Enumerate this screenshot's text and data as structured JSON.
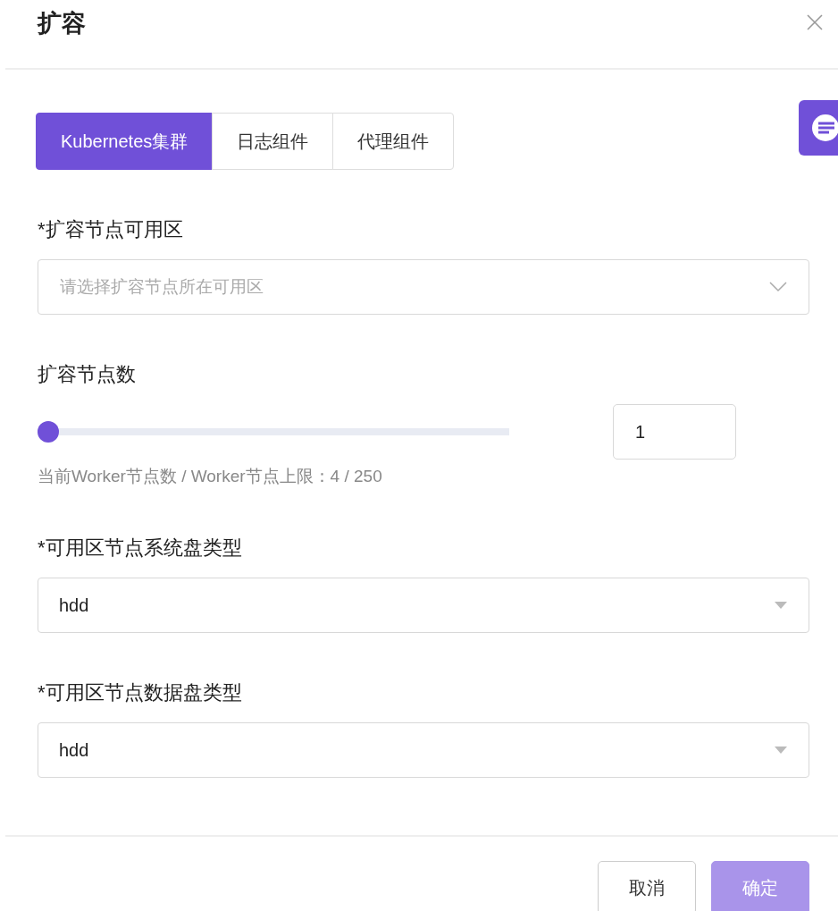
{
  "dialog": {
    "title": "扩容"
  },
  "tabs": [
    {
      "label": "Kubernetes集群",
      "selected": true
    },
    {
      "label": "日志组件",
      "selected": false
    },
    {
      "label": "代理组件",
      "selected": false
    }
  ],
  "zone": {
    "label": "*扩容节点可用区",
    "placeholder": "请选择扩容节点所在可用区"
  },
  "node_count": {
    "label": "扩容节点数",
    "level": 0,
    "value": "1",
    "hint": "当前Worker节点数 / Worker节点上限：4 / 250"
  },
  "system_disk": {
    "label": "*可用区节点系统盘类型",
    "value": "hdd"
  },
  "data_disk": {
    "label": "*可用区节点数据盘类型",
    "value": "hdd"
  },
  "buttons": [
    {
      "label": "取消",
      "kind": "secondary",
      "disabled": false
    },
    {
      "label": "确定",
      "kind": "primary",
      "disabled": true
    }
  ]
}
